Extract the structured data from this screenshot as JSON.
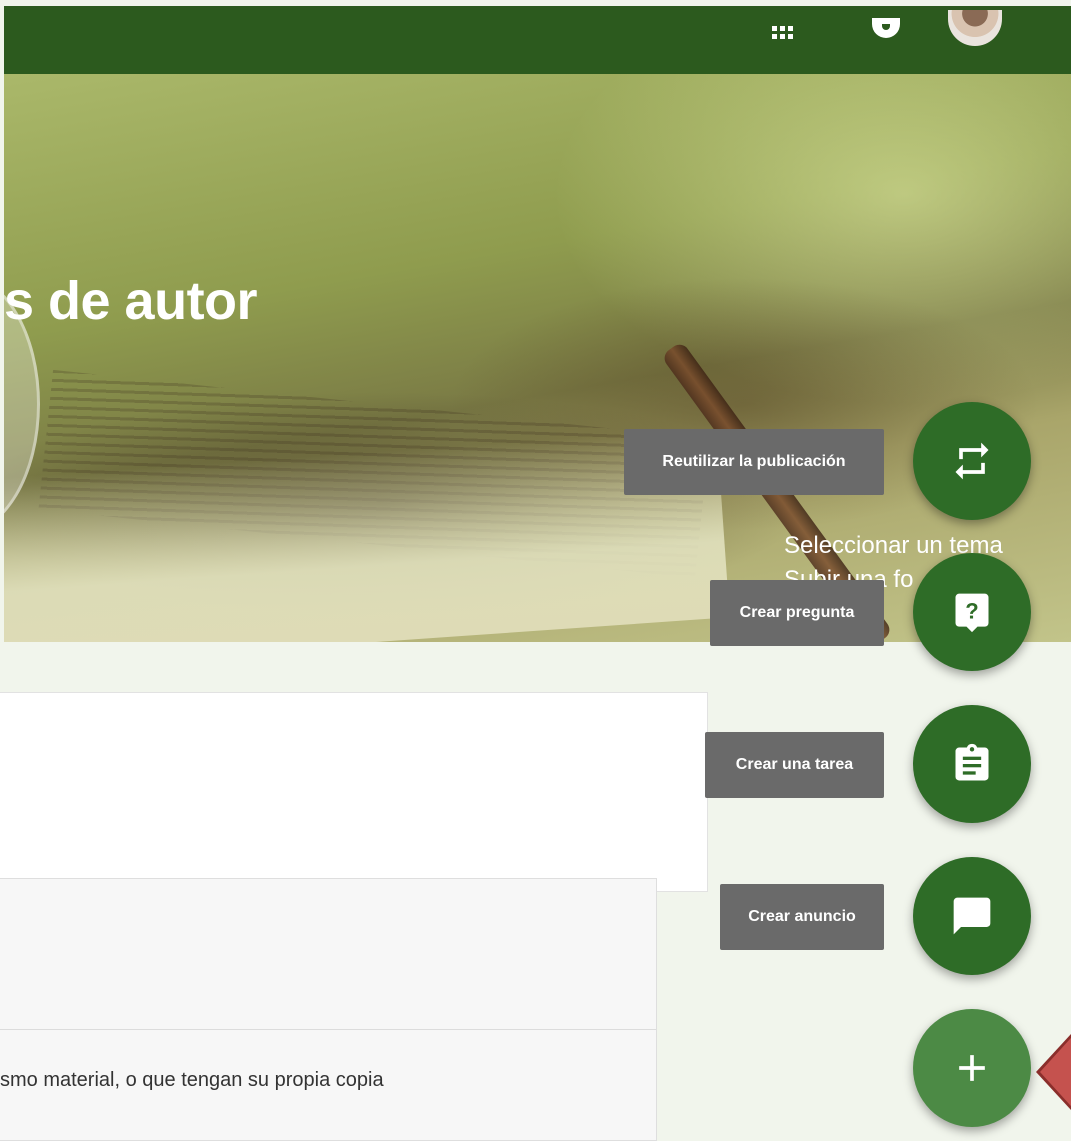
{
  "header": {
    "apps_icon": "apps-grid-icon",
    "notifications_icon": "bell-icon",
    "account_icon": "avatar"
  },
  "banner": {
    "course_title": "s de autor",
    "links": [
      "Seleccionar un tema",
      "Subir una fo"
    ]
  },
  "stream": {
    "card_text": "smo material, o que tengan su propia copia"
  },
  "fab_menu": {
    "items": [
      {
        "label": "Reutilizar la publicación",
        "icon": "repost-icon"
      },
      {
        "label": "Crear pregunta",
        "icon": "question-icon"
      },
      {
        "label": "Crear una tarea",
        "icon": "assignment-icon"
      },
      {
        "label": "Crear anuncio",
        "icon": "announcement-icon"
      }
    ],
    "main_icon": "plus-icon"
  },
  "colors": {
    "topbar": "#2c5a1e",
    "fab": "#2e6c27",
    "fab_main": "#4c8a45",
    "tooltip": "#6a6a6a",
    "pointer_arrow": "#c5524e"
  }
}
